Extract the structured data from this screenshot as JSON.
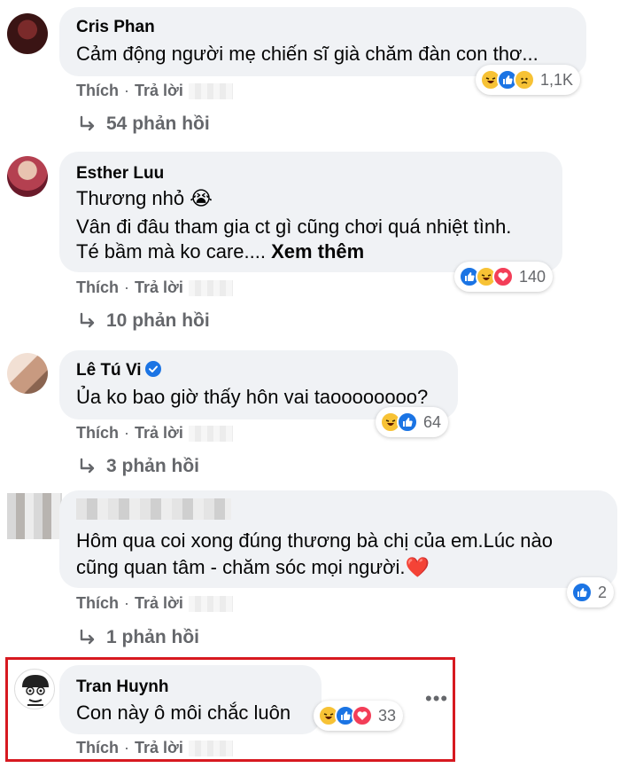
{
  "comments": [
    {
      "author": "Cris Phan",
      "lines": [
        "Cảm động người mẹ chiến sĩ già chăm đàn con thơ..."
      ],
      "reaction_count": "1,1K",
      "reaction_icons": [
        "haha-icon",
        "like-icon",
        "sad-icon"
      ],
      "like_label": "Thích",
      "reply_label": "Trả lời",
      "replies_label": "54 phản hồi"
    },
    {
      "author": "Esther Luu",
      "lines": [
        "Thương nhỏ 😭",
        "Vân đi đâu tham gia ct gì cũng chơi quá nhiệt tình.",
        "Té bầm mà ko care.... "
      ],
      "see_more": "Xem thêm",
      "reaction_count": "140",
      "reaction_icons": [
        "like-icon",
        "haha-icon",
        "love-icon"
      ],
      "like_label": "Thích",
      "reply_label": "Trả lời",
      "replies_label": "10 phản hồi"
    },
    {
      "author": "Lê Tú Vi",
      "lines": [
        "Ủa ko bao giờ thấy hôn vai taoooooooo?"
      ],
      "reaction_count": "64",
      "reaction_icons": [
        "haha-icon",
        "like-icon"
      ],
      "like_label": "Thích",
      "reply_label": "Trả lời",
      "replies_label": "3 phản hồi"
    },
    {
      "author": "",
      "lines": [
        "Hôm qua coi xong đúng thương bà chị của em.Lúc nào",
        "cũng quan tâm - chăm sóc mọi người.❤️"
      ],
      "reaction_count": "2",
      "reaction_icons": [
        "like-icon"
      ],
      "like_label": "Thích",
      "reply_label": "Trả lời",
      "replies_label": "1 phản hồi"
    },
    {
      "author": "Tran Huynh",
      "lines": [
        "Con này ô môi chắc luôn"
      ],
      "reaction_count": "33",
      "reaction_icons": [
        "haha-icon",
        "like-icon",
        "love-icon"
      ],
      "like_label": "Thích",
      "reply_label": "Trả lời",
      "more_label": "•••"
    }
  ],
  "colors": {
    "bubble": "#f0f2f5",
    "secondary_text": "#65676b",
    "like_blue": "#1b74e4",
    "highlight_red": "#d71920"
  }
}
